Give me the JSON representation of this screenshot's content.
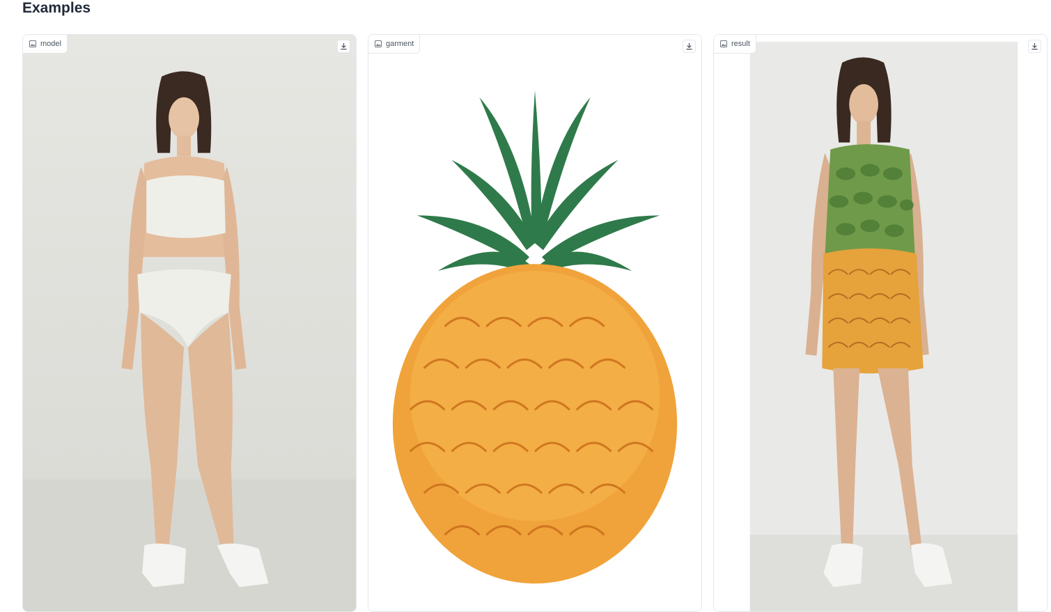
{
  "section": {
    "title": "Examples"
  },
  "examples": [
    {
      "label": "model",
      "icon": "image-icon",
      "download_icon": "download-icon"
    },
    {
      "label": "garment",
      "icon": "image-icon",
      "download_icon": "download-icon"
    },
    {
      "label": "result",
      "icon": "image-icon",
      "download_icon": "download-icon"
    }
  ]
}
